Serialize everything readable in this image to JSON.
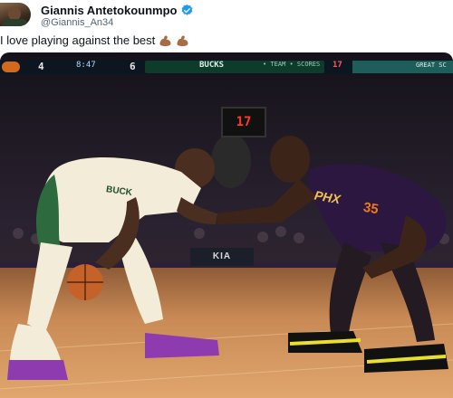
{
  "tweet": {
    "author_name": "Giannis Antetokounmpo",
    "author_handle": "@Giannis_An34",
    "verified": true,
    "text": "I love playing against the best",
    "emojis": [
      "flexed-biceps",
      "flexed-biceps"
    ]
  },
  "photo": {
    "scorebug": {
      "left_score": "4",
      "clock": "8:47",
      "right_score": "6",
      "banner": "BUCKS",
      "banner_info": "• TEAM • SCORES",
      "red_number": "17",
      "right_label": "GREAT SC"
    },
    "shot_clock": "17",
    "arena_sign": "KIA",
    "left_jersey_text": "BUCK",
    "right_jersey_text": "PHX",
    "right_jersey_number": "35"
  },
  "colors": {
    "verified_blue": "#1d9bf0",
    "bucks_green": "#0e3b2a",
    "suns_orange": "#f07a1e",
    "suns_purple": "#2b1740"
  }
}
